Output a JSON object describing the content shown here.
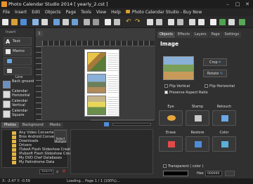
{
  "window": {
    "title": "Photo Calendar Studio 2014 [ yearly_2.cst ]",
    "minimize": "–",
    "maximize": "□",
    "close": "✕"
  },
  "menu": {
    "items": [
      "File",
      "Insert",
      "Edit",
      "Objects",
      "Page",
      "Tools",
      "View",
      "Help"
    ],
    "buy": "Photo Calendar Studio - Buy Now"
  },
  "left": {
    "insert_header": "Insert",
    "text": "Text",
    "memo": "Memo",
    "line": "Line",
    "background": "Back ground",
    "layouts": [
      "Calendar Horizontal",
      "Calendar Vertical",
      "Calendar Square"
    ]
  },
  "canvas": {
    "tab_label": "1"
  },
  "bottom": {
    "tabs": [
      "Photos",
      "Background",
      "Masks"
    ],
    "files": [
      "Any Video Converter",
      "Bros Android Converter",
      "Downloads",
      "Drivers",
      "iTubeA Flash Slideshow Creator",
      "iPubsoft Flash Slideshow Creator",
      "My DVD Chef Databases",
      "My Palindrome Data"
    ],
    "select_label": "Select Multiple",
    "search_placeholder": "Search"
  },
  "right": {
    "tabs": [
      "Objects",
      "Effects",
      "Layers",
      "Page",
      "Settings"
    ],
    "section_title": "Image",
    "crop": "Crop",
    "rotate": "Rotate",
    "flip_vertical": "Flip Vertical",
    "flip_horizontal": "Flip Horizontal",
    "preserve_aspect": "Preserve Aspect Ratio",
    "tools": [
      "Eye",
      "Stamp",
      "Retouch",
      "Erase",
      "Restore",
      "Color"
    ],
    "transparent": "Transparent ( color )",
    "hex_label": "Hex",
    "hex_value": "000000"
  },
  "status": {
    "coords": "X: -2.47 Y: -0.59",
    "loading": "Loading... Page 1 / 1 (100%)..."
  }
}
